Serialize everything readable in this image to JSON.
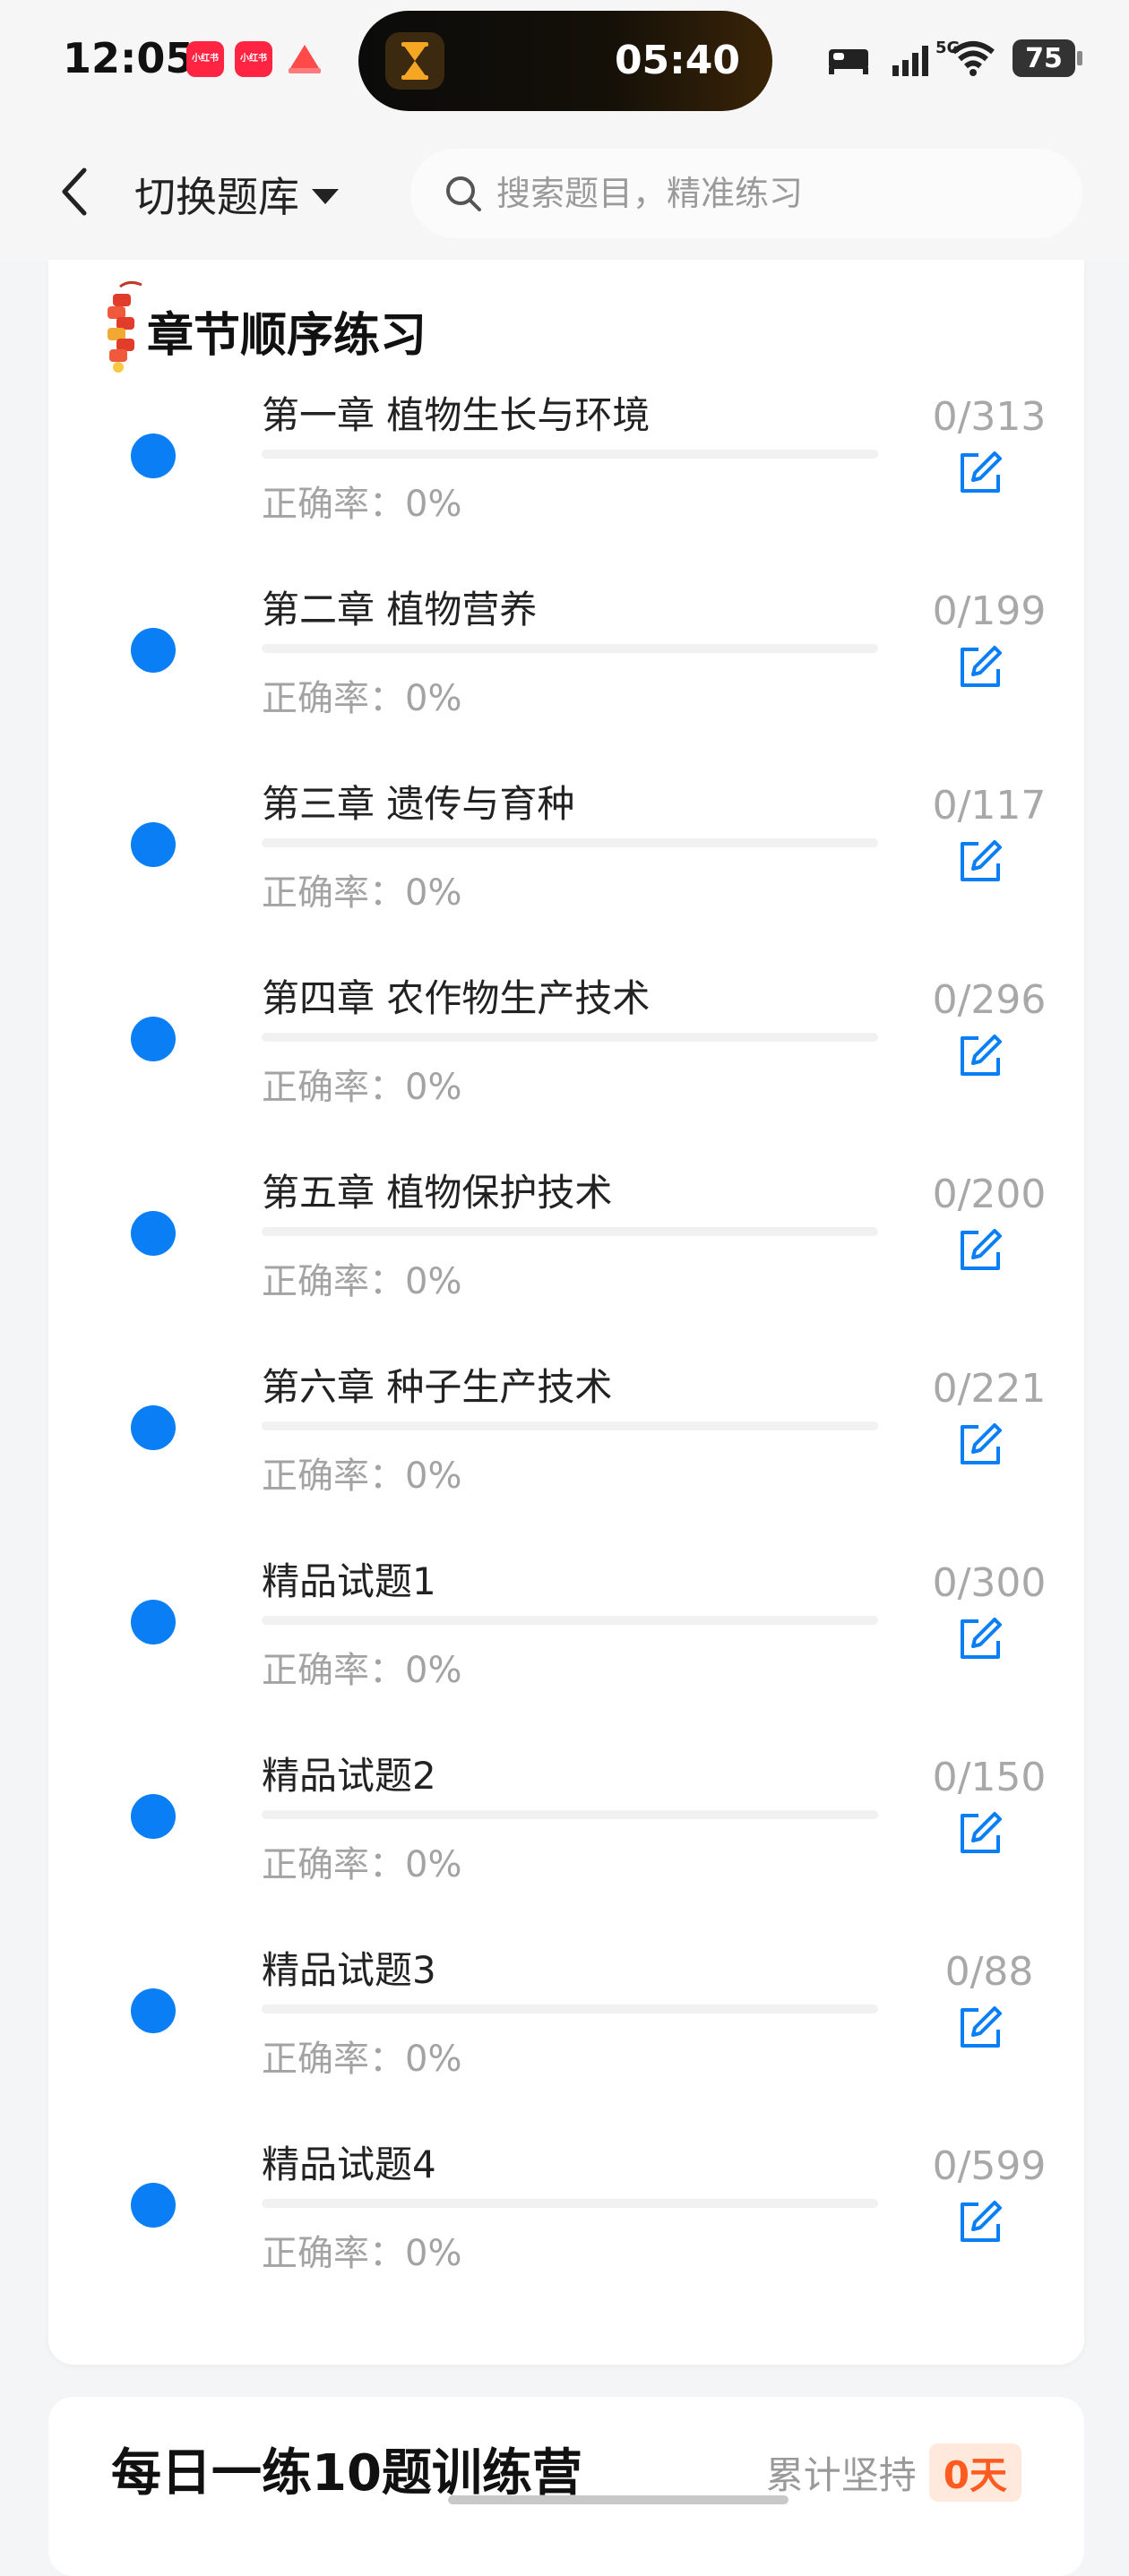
{
  "status_bar": {
    "time": "12:05",
    "apps": [
      "小红书",
      "小红书"
    ],
    "island_timer": "05:40",
    "network": "5G",
    "battery": "75"
  },
  "header": {
    "switch_label": "切换题库",
    "search_placeholder": "搜索题目，精准练习"
  },
  "section": {
    "title": "章节顺序练习",
    "chapters": [
      {
        "name": "第一章 植物生长与环境",
        "accuracy": "正确率：0%",
        "count": "0/313",
        "progress": 0
      },
      {
        "name": "第二章 植物营养",
        "accuracy": "正确率：0%",
        "count": "0/199",
        "progress": 0
      },
      {
        "name": "第三章 遗传与育种",
        "accuracy": "正确率：0%",
        "count": "0/117",
        "progress": 0
      },
      {
        "name": "第四章 农作物生产技术",
        "accuracy": "正确率：0%",
        "count": "0/296",
        "progress": 0
      },
      {
        "name": "第五章 植物保护技术",
        "accuracy": "正确率：0%",
        "count": "0/200",
        "progress": 0
      },
      {
        "name": "第六章 种子生产技术",
        "accuracy": "正确率：0%",
        "count": "0/221",
        "progress": 0
      },
      {
        "name": "精品试题1",
        "accuracy": "正确率：0%",
        "count": "0/300",
        "progress": 0
      },
      {
        "name": "精品试题2",
        "accuracy": "正确率：0%",
        "count": "0/150",
        "progress": 0
      },
      {
        "name": "精品试题3",
        "accuracy": "正确率：0%",
        "count": "0/88",
        "progress": 0
      },
      {
        "name": "精品试题4",
        "accuracy": "正确率：0%",
        "count": "0/599",
        "progress": 0
      }
    ]
  },
  "daily": {
    "title": "每日一练10题训练营",
    "streak_label": "累计坚持",
    "streak_days": "0天"
  },
  "colors": {
    "accent": "#0a7ff5",
    "streak": "#ff5a1f"
  }
}
